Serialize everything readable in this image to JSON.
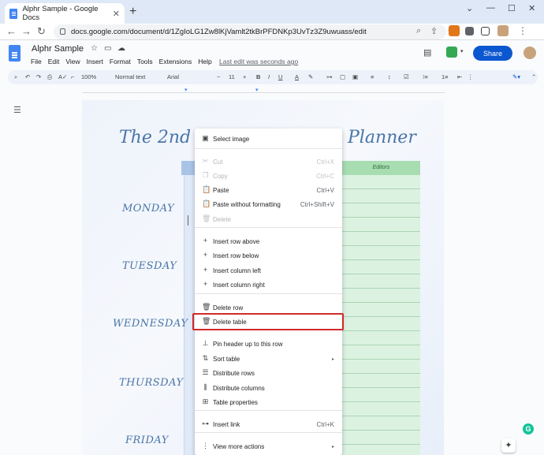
{
  "browser": {
    "tab_title": "Alphr Sample - Google Docs",
    "url": "docs.google.com/document/d/1ZgIoLG1Zw8lKjVamlt2tkBrPFDNKp3UvTz3Z9uwuass/edit"
  },
  "docs": {
    "title": "Alphr Sample",
    "menu": [
      "File",
      "Edit",
      "View",
      "Insert",
      "Format",
      "Tools",
      "Extensions",
      "Help"
    ],
    "last_edit": "Last edit was seconds ago",
    "share_label": "Share",
    "toolbar": {
      "zoom": "100%",
      "style": "Normal text",
      "font": "Arial",
      "size": "11"
    }
  },
  "document": {
    "heading_left": "The 2nd",
    "heading_right": "Planner",
    "green_header": "Editors",
    "days": [
      "MONDAY",
      "TUESDAY",
      "WEDNESDAY",
      "THURSDAY",
      "FRIDAY"
    ]
  },
  "context_menu": {
    "items": [
      {
        "label": "Select image",
        "shortcut": "",
        "icon": "image-icon",
        "disabled": false
      },
      {
        "label": "Cut",
        "shortcut": "Ctrl+X",
        "icon": "cut-icon",
        "disabled": true
      },
      {
        "label": "Copy",
        "shortcut": "Ctrl+C",
        "icon": "copy-icon",
        "disabled": true
      },
      {
        "label": "Paste",
        "shortcut": "Ctrl+V",
        "icon": "paste-icon",
        "disabled": false
      },
      {
        "label": "Paste without formatting",
        "shortcut": "Ctrl+Shift+V",
        "icon": "paste-plain-icon",
        "disabled": false
      },
      {
        "label": "Delete",
        "shortcut": "",
        "icon": "trash-icon",
        "disabled": true
      },
      {
        "label": "Insert row above",
        "shortcut": "",
        "icon": "plus-icon",
        "disabled": false
      },
      {
        "label": "Insert row below",
        "shortcut": "",
        "icon": "plus-icon",
        "disabled": false
      },
      {
        "label": "Insert column left",
        "shortcut": "",
        "icon": "plus-icon",
        "disabled": false
      },
      {
        "label": "Insert column right",
        "shortcut": "",
        "icon": "plus-icon",
        "disabled": false
      },
      {
        "label": "Delete row",
        "shortcut": "",
        "icon": "trash-icon",
        "disabled": false
      },
      {
        "label": "Delete table",
        "shortcut": "",
        "icon": "trash-icon",
        "disabled": false,
        "highlighted": true
      },
      {
        "label": "Pin header up to this row",
        "shortcut": "",
        "icon": "pin-icon",
        "disabled": false
      },
      {
        "label": "Sort table",
        "shortcut": "",
        "icon": "sort-icon",
        "disabled": false,
        "submenu": true
      },
      {
        "label": "Distribute rows",
        "shortcut": "",
        "icon": "distribute-rows-icon",
        "disabled": false
      },
      {
        "label": "Distribute columns",
        "shortcut": "",
        "icon": "distribute-columns-icon",
        "disabled": false
      },
      {
        "label": "Table properties",
        "shortcut": "",
        "icon": "table-icon",
        "disabled": false
      },
      {
        "label": "Insert link",
        "shortcut": "Ctrl+K",
        "icon": "link-icon",
        "disabled": false
      },
      {
        "label": "View more actions",
        "shortcut": "",
        "icon": "more-vert-icon",
        "disabled": false,
        "submenu": true
      }
    ]
  }
}
